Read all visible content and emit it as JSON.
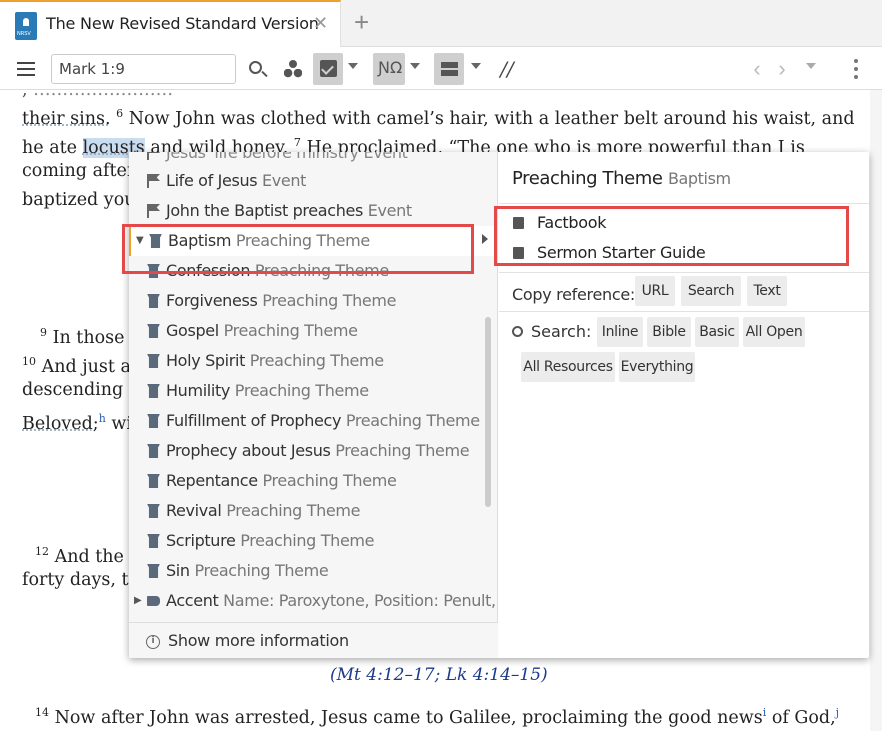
{
  "tab": {
    "title": "The New Revised Standard Version",
    "icon_label": "NRSV",
    "close_icon": "close-icon",
    "new_tab_label": "+"
  },
  "toolbar": {
    "reference": "Mark 1:9",
    "parallel_label": "//"
  },
  "bible": {
    "line1": "their sins.",
    "line1_v": "6",
    "line1_b": " Now John was clothed with camel’s hair, with a leather belt around his waist, and",
    "line2_a": "he ate ",
    "line2_hl": "locusts",
    "line2_b": " and wild honey.",
    "line2_v": "7",
    "line2_c": " He proclaimed, “The one who is more powerful than I is",
    "line3": "coming after",
    "line4": "baptized you",
    "v9_num": "9",
    "v9_text": " In those",
    "v10_num": "10",
    "v10_text": " And just a",
    "line7": "descending",
    "line8": "Beloved;",
    "line8_note": "h",
    "line8_b": " wi",
    "v12_num": "12",
    "v12_text": " And the",
    "line10": "forty days, te",
    "xref": "(Mt 4:12–17; Lk 4:14–15)",
    "v14_num": "14",
    "v14_text": " Now after John was arrested, Jesus came to Galilee, proclaiming the good news",
    "v14_note_i": "i",
    "v14_text_b": " of God,",
    "v14_note_j": "j",
    "top_partial": "Jesus' life before ministry Event"
  },
  "popup": {
    "items": [
      {
        "name": "Life of Jesus",
        "kind": "Event",
        "icon": "flag-icon"
      },
      {
        "name": "John the Baptist preaches",
        "kind": "Event",
        "icon": "flag-icon"
      },
      {
        "name": "Baptism",
        "kind": "Preaching Theme",
        "icon": "lectern-icon"
      },
      {
        "name": "Confession",
        "kind": "Preaching Theme",
        "icon": "lectern-icon"
      },
      {
        "name": "Forgiveness",
        "kind": "Preaching Theme",
        "icon": "lectern-icon"
      },
      {
        "name": "Gospel",
        "kind": "Preaching Theme",
        "icon": "lectern-icon"
      },
      {
        "name": "Holy Spirit",
        "kind": "Preaching Theme",
        "icon": "lectern-icon"
      },
      {
        "name": "Humility",
        "kind": "Preaching Theme",
        "icon": "lectern-icon"
      },
      {
        "name": "Fulfillment of Prophecy",
        "kind": "Preaching Theme",
        "icon": "lectern-icon"
      },
      {
        "name": "Prophecy about Jesus",
        "kind": "Preaching Theme",
        "icon": "lectern-icon"
      },
      {
        "name": "Repentance",
        "kind": "Preaching Theme",
        "icon": "lectern-icon"
      },
      {
        "name": "Revival",
        "kind": "Preaching Theme",
        "icon": "lectern-icon"
      },
      {
        "name": "Scripture",
        "kind": "Preaching Theme",
        "icon": "lectern-icon"
      },
      {
        "name": "Sin",
        "kind": "Preaching Theme",
        "icon": "lectern-icon"
      },
      {
        "name": "Accent",
        "kind": "Name: Paroxytone, Position: Penult,…",
        "icon": "tag-icon"
      }
    ],
    "show_more": "Show more information",
    "info_glyph": "i",
    "detail": {
      "title_name": "Preaching Theme",
      "title_kind": "Baptism",
      "links": [
        {
          "label": "Factbook",
          "icon": "factbook-icon"
        },
        {
          "label": "Sermon Starter Guide",
          "icon": "sermon-icon"
        }
      ],
      "copy_label": "Copy reference:",
      "copy_chips": [
        "URL",
        "Search",
        "Text"
      ],
      "search_label": "Search:",
      "search_chips": [
        "Inline",
        "Bible",
        "Basic",
        "All Open",
        "All Resources",
        "Everything"
      ]
    }
  },
  "colors": {
    "accent": "#f0a030",
    "highlight": "#c9dcf0",
    "annotation": "#e54848"
  }
}
